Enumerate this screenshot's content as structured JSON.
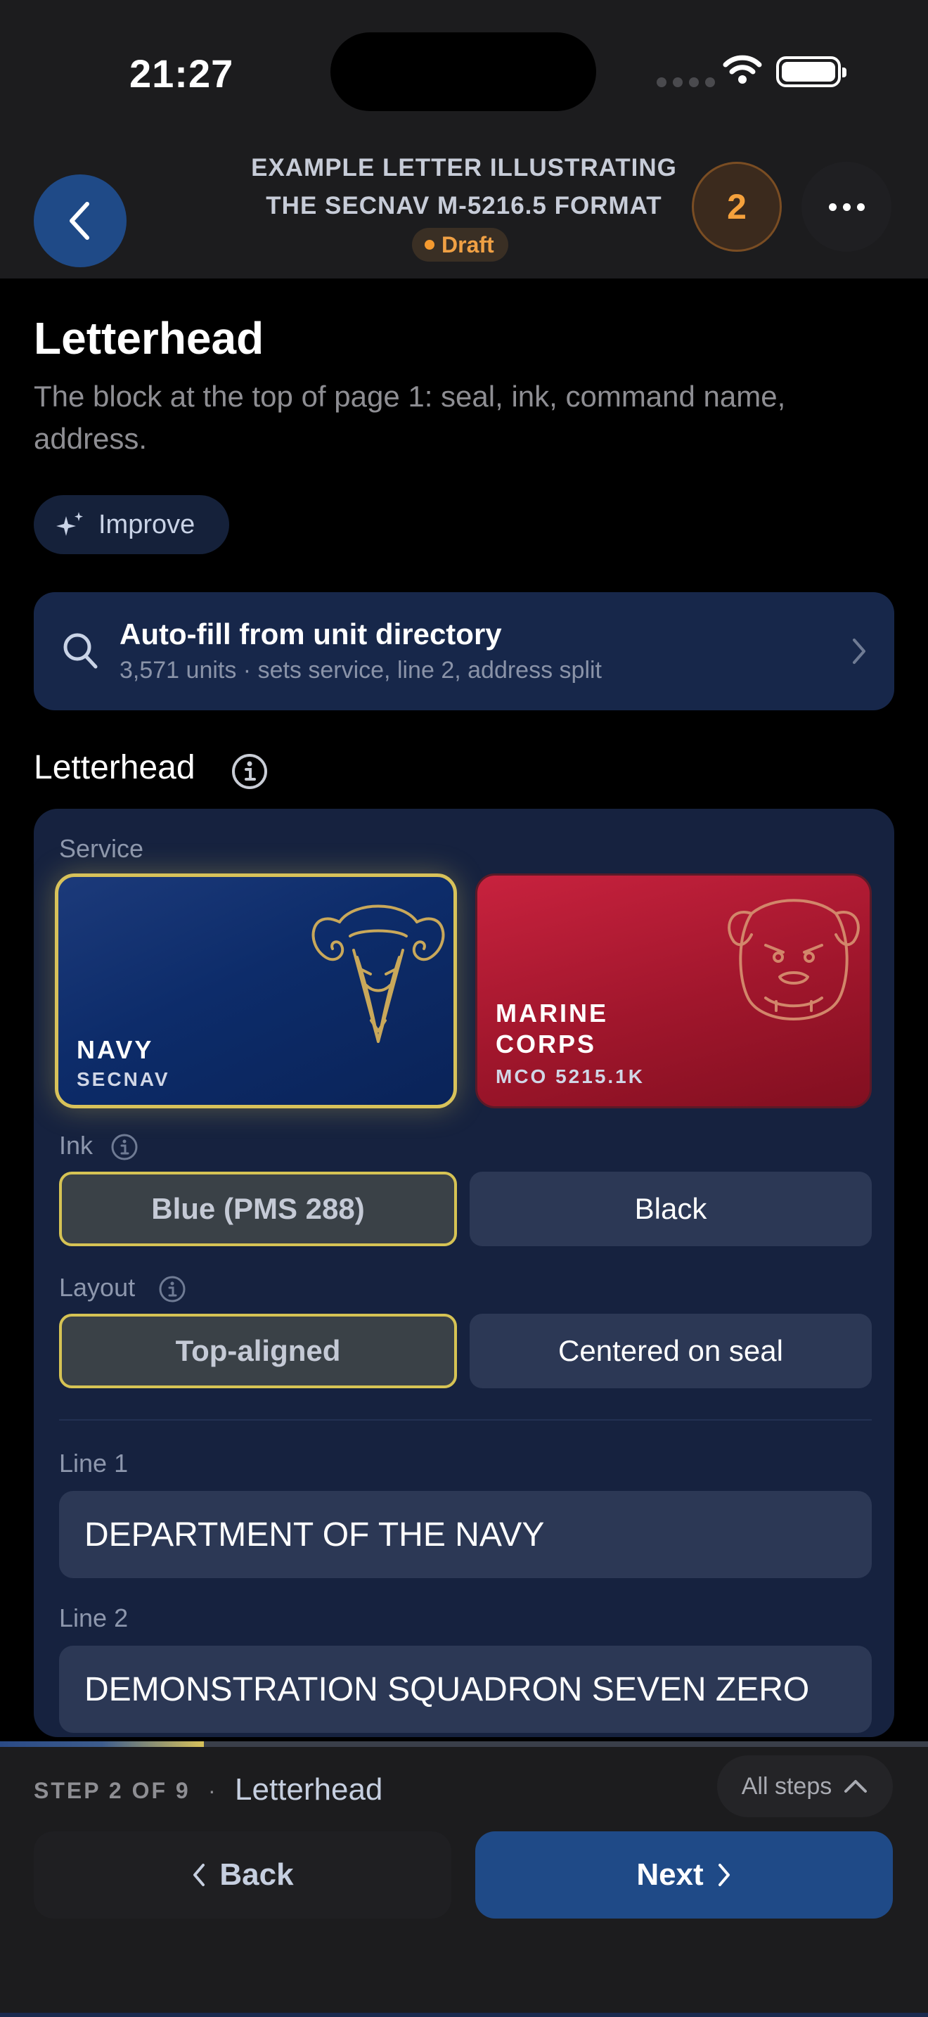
{
  "status_bar": {
    "time": "21:27"
  },
  "header": {
    "title_line1": "EXAMPLE LETTER ILLUSTRATING",
    "title_line2": "THE SECNAV M-5216.5 FORMAT",
    "status": "Draft",
    "count": "2"
  },
  "page": {
    "title": "Letterhead",
    "description": "The block at the top of page 1: seal, ink, command name, address.",
    "improve_label": "Improve"
  },
  "autofill": {
    "title": "Auto-fill from unit directory",
    "subtitle": "3,571 units · sets service, line 2, address split"
  },
  "section": {
    "title": "Letterhead",
    "service_label": "Service",
    "services": [
      {
        "name": "NAVY",
        "sub": "SECNAV",
        "selected": true,
        "color": "#0d2c6a"
      },
      {
        "name_line1": "MARINE",
        "name_line2": "CORPS",
        "sub": "MCO 5215.1K",
        "selected": false,
        "color": "#a0162c"
      }
    ],
    "ink_label": "Ink",
    "ink_options": [
      "Blue (PMS 288)",
      "Black"
    ],
    "ink_selected": "Blue (PMS 288)",
    "layout_label": "Layout",
    "layout_options": [
      "Top-aligned",
      "Centered on seal"
    ],
    "layout_selected": "Top-aligned",
    "line1_label": "Line 1",
    "line1_value": "DEPARTMENT OF THE NAVY",
    "line2_label": "Line 2",
    "line2_value": "DEMONSTRATION SQUADRON SEVEN ZERO"
  },
  "footer": {
    "step_label": "STEP 2 OF 9",
    "separator": "·",
    "step_name": "Letterhead",
    "all_steps_label": "All steps",
    "back_label": "Back",
    "next_label": "Next",
    "progress": 0.22
  },
  "colors": {
    "accent_blue": "#1f4a87",
    "selection_gold": "#d6c354",
    "draft_orange": "#f59a2f"
  }
}
